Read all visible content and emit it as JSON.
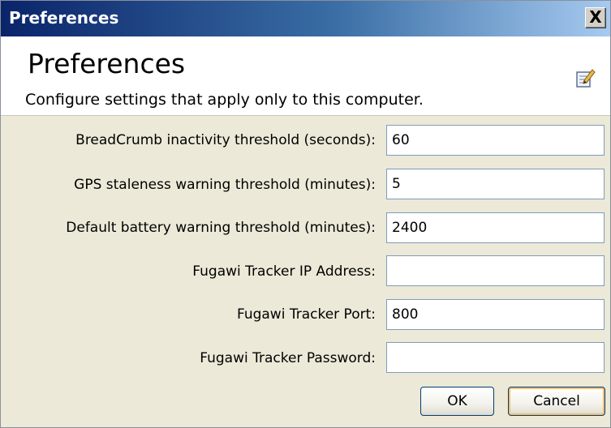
{
  "window": {
    "title": "Preferences",
    "close_label": "X"
  },
  "header": {
    "title": "Preferences",
    "subtitle": "Configure settings that apply only to this computer.",
    "icon": "edit-icon"
  },
  "fields": [
    {
      "label": "BreadCrumb inactivity threshold (seconds):",
      "value": "60"
    },
    {
      "label": "GPS staleness warning threshold (minutes):",
      "value": "5"
    },
    {
      "label": "Default battery warning threshold (minutes):",
      "value": "2400"
    },
    {
      "label": "Fugawi Tracker IP Address:",
      "value": ""
    },
    {
      "label": "Fugawi Tracker Port:",
      "value": "800"
    },
    {
      "label": "Fugawi Tracker Password:",
      "value": ""
    }
  ],
  "buttons": {
    "ok_label": "OK",
    "cancel_label": "Cancel"
  },
  "colors": {
    "titlebar_start": "#0a246a",
    "titlebar_end": "#a6caf0",
    "dialog_background": "#ece9d8",
    "input_border": "#7f9db9",
    "default_button_highlight": "#f5be6a"
  }
}
